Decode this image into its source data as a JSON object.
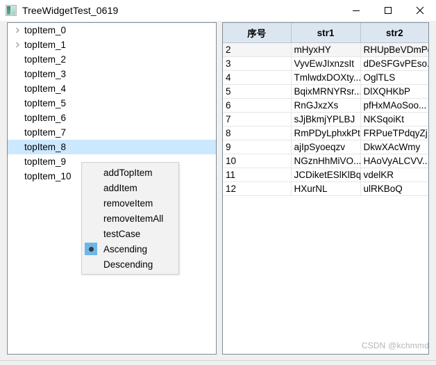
{
  "window": {
    "title": "TreeWidgetTest_0619",
    "icon": "app-icon",
    "buttons": {
      "minimize": "minimize-icon",
      "maximize": "maximize-icon",
      "close": "close-icon"
    }
  },
  "tree": {
    "items": [
      {
        "label": "topItem_0",
        "expandable": true,
        "selected": false
      },
      {
        "label": "topItem_1",
        "expandable": true,
        "selected": false
      },
      {
        "label": "topItem_2",
        "expandable": false,
        "selected": false
      },
      {
        "label": "topItem_3",
        "expandable": false,
        "selected": false
      },
      {
        "label": "topItem_4",
        "expandable": false,
        "selected": false
      },
      {
        "label": "topItem_5",
        "expandable": false,
        "selected": false
      },
      {
        "label": "topItem_6",
        "expandable": false,
        "selected": false
      },
      {
        "label": "topItem_7",
        "expandable": false,
        "selected": false
      },
      {
        "label": "topItem_8",
        "expandable": false,
        "selected": true
      },
      {
        "label": "topItem_9",
        "expandable": false,
        "selected": false
      },
      {
        "label": "topItem_10",
        "expandable": false,
        "selected": false
      }
    ]
  },
  "context_menu": {
    "items": [
      {
        "label": "addTopItem",
        "checked": false
      },
      {
        "label": "addItem",
        "checked": false
      },
      {
        "label": "removeItem",
        "checked": false
      },
      {
        "label": "removeItemAll",
        "checked": false
      },
      {
        "label": "testCase",
        "checked": false
      },
      {
        "label": "Ascending",
        "checked": true
      },
      {
        "label": "Descending",
        "checked": false
      }
    ]
  },
  "table": {
    "headers": [
      "序号",
      "str1",
      "str2"
    ],
    "rows": [
      [
        "2",
        "mHyxHY",
        "RHUpBeVDmPe"
      ],
      [
        "3",
        "VyvEwJIxnzsIt",
        "dDeSFGvPEso..."
      ],
      [
        "4",
        "TmlwdxDOXty...",
        "OglTLS"
      ],
      [
        "5",
        "BqixMRNYRsr...",
        "DlXQHKbP"
      ],
      [
        "6",
        "RnGJxzXs",
        "pfHxMAoSoo..."
      ],
      [
        "7",
        "sJjBkmjYPLBJ",
        "NKSqoiKt"
      ],
      [
        "8",
        "RmPDyLphxkPt",
        "FRPueTPdqyZj..."
      ],
      [
        "9",
        "ajIpSyoeqzv",
        "DkwXAcWmy"
      ],
      [
        "10",
        "NGznHhMiVO...",
        "HAoVyALCVV..."
      ],
      [
        "11",
        "JCDiketESlKlBq",
        "vdelKR"
      ],
      [
        "12",
        "HXurNL",
        "ulRKBoQ"
      ]
    ]
  },
  "watermark": {
    "text": "CSDN @kchmmd"
  },
  "colors": {
    "selection": "#cce8ff",
    "header_bg": "#dce6f1",
    "panel_border": "#7d8b96",
    "radio_highlight": "#6cb6e8"
  }
}
